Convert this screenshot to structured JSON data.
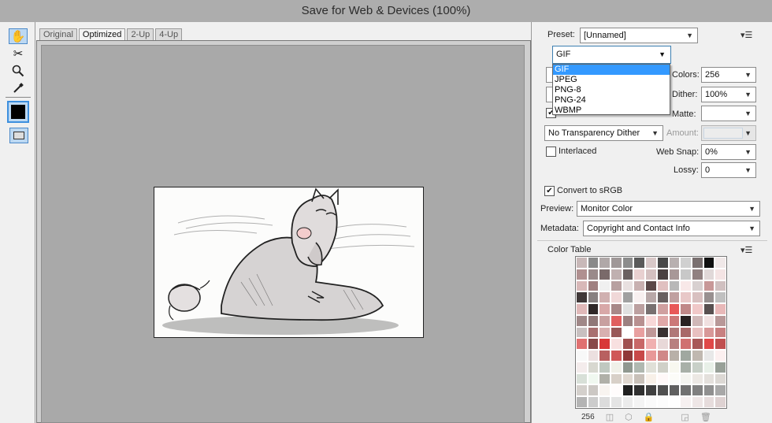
{
  "window": {
    "title": "Save for Web & Devices (100%)"
  },
  "tools": [
    {
      "name": "hand-tool-icon",
      "glyph": "✋"
    },
    {
      "name": "slice-select-tool-icon",
      "glyph": "✂"
    },
    {
      "name": "zoom-tool-icon",
      "glyph": "🔍"
    },
    {
      "name": "eyedropper-tool-icon",
      "glyph": "✎"
    }
  ],
  "tabs": [
    "Original",
    "Optimized",
    "2-Up",
    "4-Up"
  ],
  "active_tab": "Optimized",
  "settings": {
    "preset_label": "Preset:",
    "preset_value": "[Unnamed]",
    "format_value": "GIF",
    "format_options": [
      "GIF",
      "JPEG",
      "PNG-8",
      "PNG-24",
      "WBMP"
    ],
    "colors_label": "Colors:",
    "colors_value": "256",
    "dither_label": "Dither:",
    "dither_value": "100%",
    "matte_label": "Matte:",
    "matte_value": "",
    "transparency_dither_value": "No Transparency Dither",
    "amount_label": "Amount:",
    "amount_value": "",
    "interlaced_label": "Interlaced",
    "interlaced_checked": false,
    "web_snap_label": "Web Snap:",
    "web_snap_value": "0%",
    "lossy_label": "Lossy:",
    "lossy_value": "0",
    "convert_label": "Convert to sRGB",
    "convert_checked": true,
    "preview_label": "Preview:",
    "preview_value": "Monitor Color",
    "metadata_label": "Metadata:",
    "metadata_value": "Copyright and Contact Info"
  },
  "color_table": {
    "title": "Color Table",
    "count": "256",
    "colors": [
      "#c8b8b8",
      "#8a8a8a",
      "#b0a8a8",
      "#a09898",
      "#8c8c8c",
      "#5a5a5a",
      "#d8c8c8",
      "#484848",
      "#b8b0b0",
      "#d0d0d0",
      "#7a7070",
      "#101010",
      "#f0e8e8",
      "#b09090",
      "#9a8a8a",
      "#7a6a6a",
      "#c0b0b0",
      "#6a6060",
      "#e8d0d0",
      "#d4c0c0",
      "#4a4040",
      "#a89898",
      "#c8c8c8",
      "#908080",
      "#e0d8d8",
      "#f4e4e4",
      "#d8b8b8",
      "#a08080",
      "#f0f0f0",
      "#b8a0a0",
      "#e8e0e0",
      "#c8b0b0",
      "#5a4848",
      "#e0c0c0",
      "#b8b8b8",
      "#f8e8e8",
      "#d8d0d0",
      "#c89898",
      "#d0c0c0",
      "#403838",
      "#888080",
      "#d0b0b0",
      "#f0d8d8",
      "#a0a0a0",
      "#f8f0f0",
      "#b8a8a8",
      "#686060",
      "#c0a0a0",
      "#e8c8c8",
      "#d8c0c0",
      "#989090",
      "#c0c0c0",
      "#e0b8b8",
      "#302828",
      "#d8a8a8",
      "#a88888",
      "#e0e0e0",
      "#bca0a0",
      "#787070",
      "#d0a0a0",
      "#e85858",
      "#c08888",
      "#f0c8c8",
      "#585050",
      "#e8b8b8",
      "#a08888",
      "#907878",
      "#c8a0a0",
      "#e06060",
      "#9c8080",
      "#b89090",
      "#f8d8d8",
      "#e0a8a8",
      "#cc7878",
      "#282020",
      "#d0b8b8",
      "#f0e0e0",
      "#b89898",
      "#c8c0c0",
      "#a87070",
      "#d8b0b0",
      "#985858",
      "#ffffff",
      "#e8a0a0",
      "#c09898",
      "#383030",
      "#b07878",
      "#a86868",
      "#e8c0c0",
      "#d89898",
      "#c88080",
      "#e07070",
      "#884848",
      "#d83838",
      "#f8e0e0",
      "#a05050",
      "#c86868",
      "#f0b0b0",
      "#e8d8d8",
      "#b88080",
      "#d07070",
      "#a85858",
      "#e04848",
      "#c05050",
      "#f8f8f8",
      "#ece0e0",
      "#b86060",
      "#d05858",
      "#903838",
      "#c84848",
      "#e89898",
      "#d08888",
      "#b8b0a8",
      "#a0a8a0",
      "#c0b8b0",
      "#e8e8e8",
      "#fcf0f0",
      "#f4ecec",
      "#d8d8d0",
      "#c0c8c0",
      "#f0f0e8",
      "#909890",
      "#b0b8b0",
      "#e0e0d8",
      "#d0d0c8",
      "#f8f8f0",
      "#a8b0a8",
      "#c8d0c8",
      "#e8f0e8",
      "#98a098",
      "#d8e0d8",
      "#f0f8f0",
      "#b0b0a8",
      "#d8d0c8",
      "#e0d8d0",
      "#c8c0b8",
      "#f8f0e8",
      "#fff8f8",
      "#fcfcf8",
      "#f4f4f0",
      "#ece8e4",
      "#e4e0dc",
      "#dcd8d4",
      "#d4d0cc",
      "#ccc8c4",
      "#f8f4f0",
      "#fffcfc",
      "#202020",
      "#303030",
      "#404040",
      "#505050",
      "#606060",
      "#707070",
      "#808080",
      "#909090",
      "#a8a8a8",
      "#b4b4b4",
      "#cccccc",
      "#dcdcdc",
      "#e4e4e4",
      "#ececec",
      "#f4f4f4",
      "#fafafa",
      "#fcfcfc",
      "#fefefe",
      "#f6f0f0",
      "#eee6e6",
      "#e6dcdc",
      "#ded2d2",
      "#d6c8c8",
      "#cebebe",
      "#c6b4b4",
      "#beaaaa",
      "#b6a0a0",
      "#ae9696",
      "#a68c8c",
      "#9e8282",
      "#967878",
      "#8e6e6e",
      "#866464",
      "#7e5a5a",
      "#765050",
      "#6e4646",
      "#663c3c",
      "#5e3232",
      "#562828",
      "#4e1e1e",
      "#461414",
      "#3e0a0a",
      "#ffe8e8",
      "#ffd8d8",
      "#ffc8c8",
      "#ffb8b8",
      "#ffa8a8",
      "#ff9898",
      "#ff8888",
      "#ff7878",
      "#ff6868",
      "#ff5858",
      "#ff4848",
      "#ff3838",
      "#ff2828",
      "#ff1818",
      "#ff0808",
      "#f0f0f4",
      "#e8e8ec",
      "#e0e0e4",
      "#d8d8dc",
      "#d0d0d4",
      "#c8c8cc",
      "#c0c0c4",
      "#b8b8bc",
      "#b0b0b4",
      "#a8a8ac",
      "#a0a0a4",
      "#98989c",
      "#909094",
      "#88888c",
      "#808084",
      "#78787c",
      "#707074",
      "#68686c",
      "#606064",
      "#58585c",
      "#505054",
      "#48484c",
      "#404044",
      "#38383c",
      "#303034",
      "#28282c",
      "#202024",
      "#18181c",
      "#101014",
      "#08080c",
      "#000004",
      "#ffffff",
      "#fefcfc",
      "#fcf8f8",
      "#faf4f4",
      "#f8f0f0",
      "#f6ecec",
      "#f4e8e8",
      "#f2e4e4",
      "#f0e0e0",
      "#eedcdc",
      "#ecd8d8",
      "#ead4d4",
      "#e8d0d0",
      "#e6cccc",
      "#e4c8c8",
      "#e2c4c4",
      "#e0c0c0",
      "#dec0c0",
      "#dcbcbc",
      "#dab8b8",
      "#d8b4b4",
      "#d6b0b0",
      "#d4acac",
      "#d2a8a8",
      "#d0a4a4",
      "#cea0a0",
      "#cc9c9c",
      "#ca9898",
      "#c89494",
      "#c69090",
      "#c48c8c",
      "#c28888",
      "#c08484",
      "#be8080",
      "#bc7c7c",
      "#ba7878",
      "#b87474",
      "#b67070",
      "#b46c6c",
      "#b26868",
      "#b06464",
      "#ae6060",
      "#ac5c5c",
      "#aa5858",
      "#a85454",
      "#a65050",
      "#a44c4c",
      "#a24848",
      "#a04444",
      "#9e4040",
      "#9c3c3c",
      "#9a3838",
      "#983434",
      "#963030",
      "#942c2c",
      "#922828",
      "#902424",
      "#8e2020",
      "#8c1c1c",
      "#8a1818",
      "#881414",
      "#861010",
      "#840c0c",
      "#820808",
      "#800404",
      "#7e0000",
      "#202020"
    ]
  }
}
